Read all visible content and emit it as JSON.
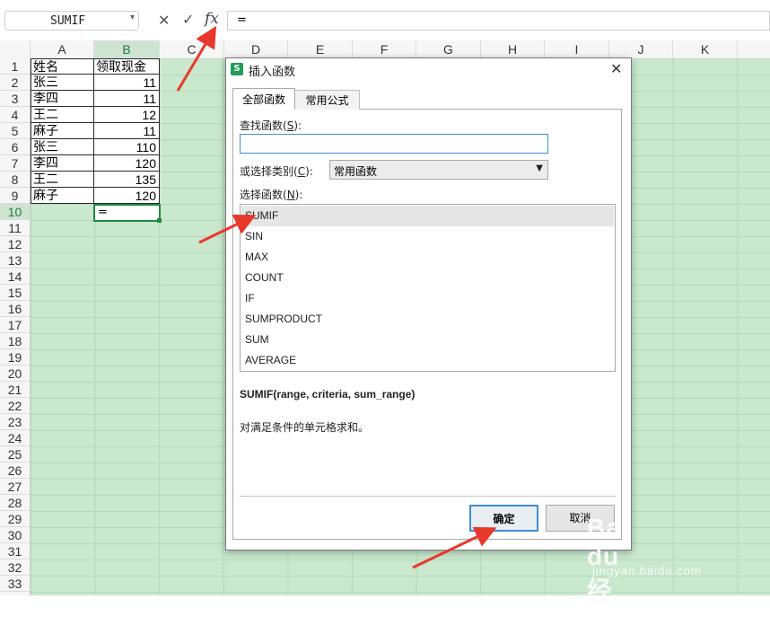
{
  "formula_bar": {
    "name_box": "SUMIF",
    "cancel_glyph": "✕",
    "enter_glyph": "✓",
    "fx_label": "fx",
    "formula": "="
  },
  "sheet": {
    "columns": [
      "A",
      "B",
      "C",
      "D",
      "E",
      "F",
      "G",
      "H",
      "I",
      "J",
      "K"
    ],
    "rows": [
      "1",
      "2",
      "3",
      "4",
      "5",
      "6",
      "7",
      "8",
      "9",
      "10",
      "11",
      "12",
      "13",
      "14",
      "15",
      "16",
      "17",
      "18",
      "19",
      "20",
      "21",
      "22",
      "23",
      "24",
      "25",
      "26",
      "27",
      "28",
      "29",
      "30",
      "31",
      "32",
      "33"
    ],
    "cells": [
      {
        "a": "姓名",
        "b": "领取现金"
      },
      {
        "a": "张三",
        "b": "11"
      },
      {
        "a": "李四",
        "b": "11"
      },
      {
        "a": "王二",
        "b": "12"
      },
      {
        "a": "麻子",
        "b": "11"
      },
      {
        "a": "张三",
        "b": "110"
      },
      {
        "a": "李四",
        "b": "120"
      },
      {
        "a": "王二",
        "b": "135"
      },
      {
        "a": "麻子",
        "b": "120"
      }
    ],
    "active_cell_value": "=",
    "colors": {
      "grid_bg": "#c9e8cd",
      "selected_header": "#cfe3d3",
      "accent": "#1e8a3d"
    }
  },
  "dialog": {
    "logo_letter": "S",
    "title": "插入函数",
    "close_glyph": "✕",
    "tabs": [
      "全部函数",
      "常用公式"
    ],
    "search_label_pre": "查找函数(",
    "search_label_key": "S",
    "search_label_post": "):",
    "search_value": "",
    "category_label_pre": "或选择类别(",
    "category_label_key": "C",
    "category_label_post": "):",
    "category_value": "常用函数",
    "dropdown_glyph": "▼",
    "list_label_pre": "选择函数(",
    "list_label_key": "N",
    "list_label_post": "):",
    "functions": [
      "SUMIF",
      "SIN",
      "MAX",
      "COUNT",
      "IF",
      "SUMPRODUCT",
      "SUM",
      "AVERAGE"
    ],
    "selected_function": "SUMIF",
    "signature": "SUMIF(range, criteria, sum_range)",
    "description": "对满足条件的单元格求和。",
    "ok_label": "确定",
    "cancel_label": "取消"
  },
  "watermark": {
    "main": "Bai du 经验",
    "sub": "jingyan.baidu.com"
  }
}
